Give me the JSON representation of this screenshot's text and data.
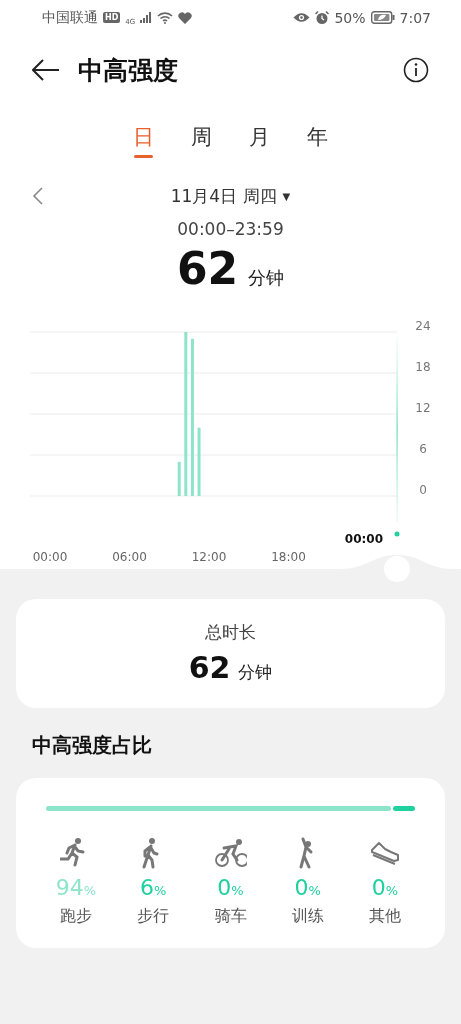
{
  "status_bar": {
    "carrier": "中国联通",
    "hd_badge": "HD",
    "network_type": "4G",
    "battery_percent": "50%",
    "time": "7:07"
  },
  "header": {
    "title": "中高强度"
  },
  "tabs": [
    {
      "label": "日",
      "selected": true
    },
    {
      "label": "周",
      "selected": false
    },
    {
      "label": "月",
      "selected": false
    },
    {
      "label": "年",
      "selected": false
    }
  ],
  "date_picker": {
    "date": "11月4日 周四",
    "caret": "▼"
  },
  "time_range": "00:00–23:59",
  "total": {
    "value": "62",
    "unit": "分钟"
  },
  "chart": {
    "cursor_label": "00:00",
    "chart_data": {
      "type": "bar",
      "x": [
        9.75,
        10.25,
        10.75,
        11.25
      ],
      "values": [
        5,
        24,
        23,
        10
      ],
      "xlim": [
        -1.5,
        26.2
      ],
      "grid": true,
      "ylim": [
        0,
        24
      ],
      "xticks": [
        {
          "value": 0,
          "label": "00:00"
        },
        {
          "value": 6,
          "label": "06:00"
        },
        {
          "value": 12,
          "label": "12:00"
        },
        {
          "value": 18,
          "label": "18:00"
        }
      ],
      "yticks": [
        0,
        6,
        12,
        18,
        24
      ]
    }
  },
  "total_card": {
    "label": "总时长",
    "value": "62",
    "unit": "分钟"
  },
  "share_title": "中高强度占比",
  "share_items": [
    {
      "kind": "running",
      "value": "94",
      "unit": "%",
      "label": "跑步",
      "color": "#8ee4c9"
    },
    {
      "kind": "walking",
      "value": "6",
      "unit": "%",
      "label": "步行",
      "color": "#1fd19e"
    },
    {
      "kind": "cycling",
      "value": "0",
      "unit": "%",
      "label": "骑车",
      "color": "#1fd19e"
    },
    {
      "kind": "training",
      "value": "0",
      "unit": "%",
      "label": "训练",
      "color": "#1fd19e"
    },
    {
      "kind": "other",
      "value": "0",
      "unit": "%",
      "label": "其他",
      "color": "#1fd19e"
    }
  ]
}
